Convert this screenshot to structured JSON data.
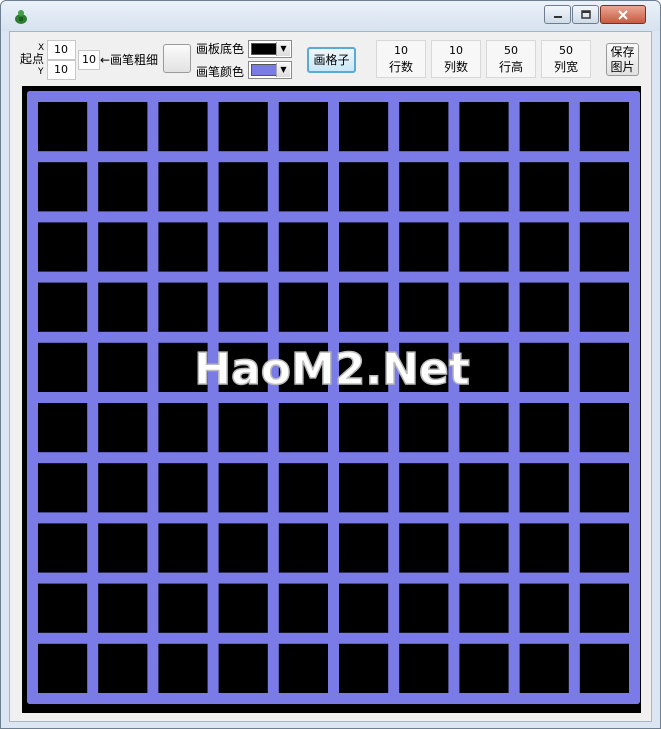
{
  "window": {
    "controls": {
      "minimize_icon": "minimize-icon",
      "maximize_icon": "maximize-icon",
      "close_icon": "close-icon"
    }
  },
  "toolbar": {
    "start_point_label": "起点",
    "x_axis_label": "X",
    "y_axis_label": "Y",
    "start_x": "10",
    "start_y": "10",
    "pen_width": "10",
    "pen_width_label": "←画笔粗细",
    "canvas_bg_label": "画板底色",
    "pen_color_label": "画笔颜色",
    "draw_grid_button": "画格子",
    "save_line1": "保存",
    "save_line2": "图片",
    "params": [
      {
        "value": "10",
        "label": "行数"
      },
      {
        "value": "10",
        "label": "列数"
      },
      {
        "value": "50",
        "label": "行高"
      },
      {
        "value": "50",
        "label": "列宽"
      }
    ]
  },
  "colors": {
    "canvas_background": "#000000",
    "pen_color": "#7b7be8",
    "watermark": "#ffffff"
  },
  "grid": {
    "rows": 10,
    "columns": 10,
    "row_height": 50,
    "column_width": 50,
    "pen_width": 10
  },
  "watermark": {
    "text": "HaoM2.Net"
  }
}
